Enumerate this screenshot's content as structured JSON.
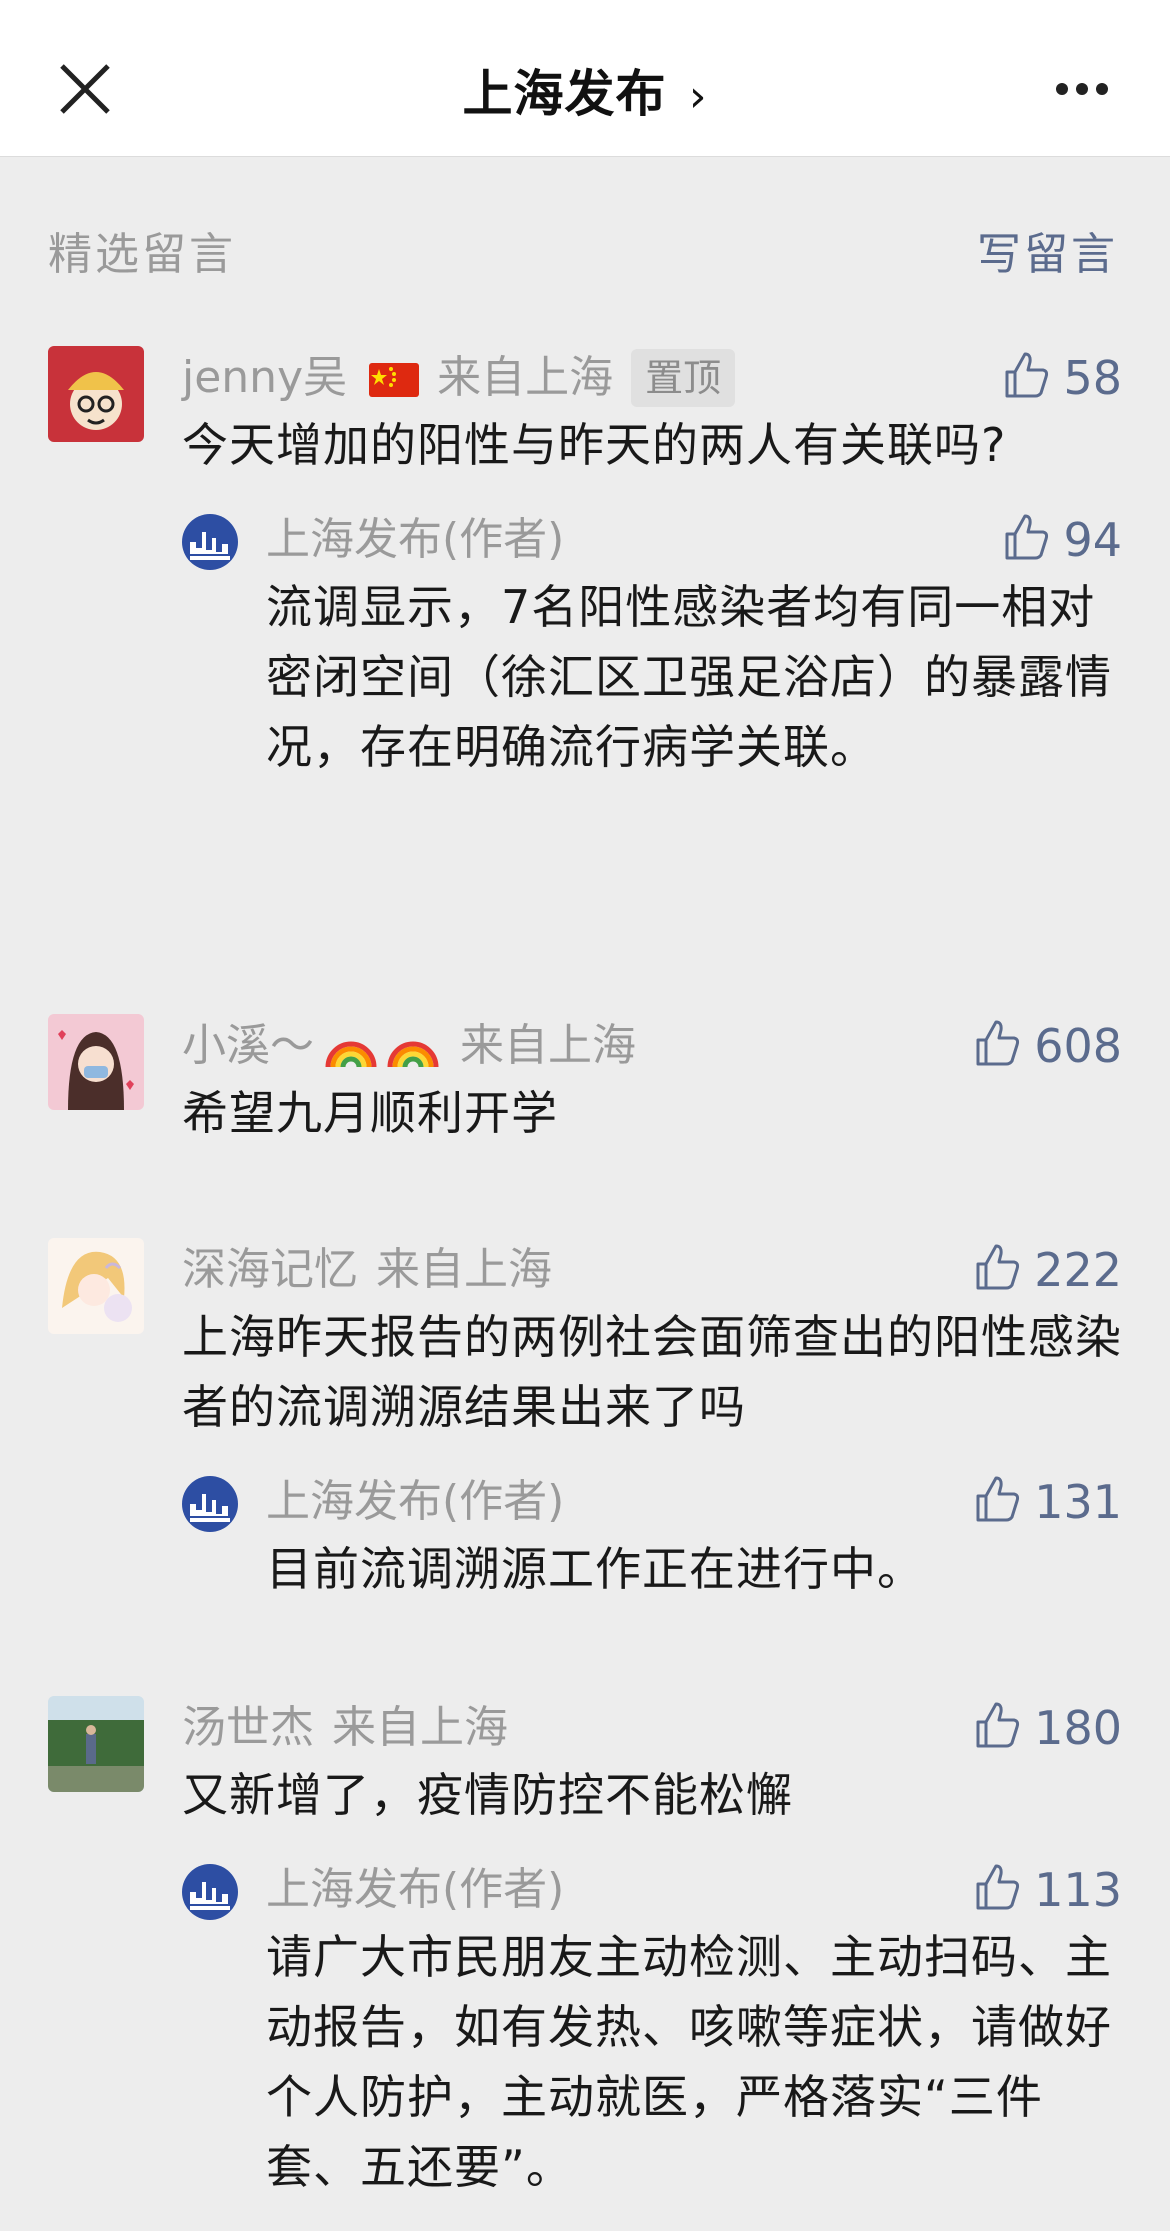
{
  "nav": {
    "title": "上海发布",
    "arrow": "›"
  },
  "section": {
    "label": "精选留言",
    "write": "写留言"
  },
  "comments": [
    {
      "name": "jenny吴",
      "location": "来自上海",
      "tag": "置顶",
      "likes": "58",
      "text": "今天增加的阳性与昨天的两人有关联吗?",
      "reply": {
        "name": "上海发布(作者)",
        "likes": "94",
        "text": "流调显示，7名阳性感染者均有同一相对密闭空间（徐汇区卫强足浴店）的暴露情况，存在明确流行病学关联。"
      }
    },
    {
      "name": "小溪～",
      "location": "来自上海",
      "likes": "608",
      "text": "希望九月顺利开学"
    },
    {
      "name": "深海记忆",
      "location": "来自上海",
      "likes": "222",
      "text": "上海昨天报告的两例社会面筛查出的阳性感染者的流调溯源结果出来了吗",
      "reply": {
        "name": "上海发布(作者)",
        "likes": "131",
        "text": "目前流调溯源工作正在进行中。"
      }
    },
    {
      "name": "汤世杰",
      "location": "来自上海",
      "likes": "180",
      "text": "又新增了，疫情防控不能松懈",
      "reply": {
        "name": "上海发布(作者)",
        "likes": "113",
        "text": "请广大市民朋友主动检测、主动扫码、主动报告，如有发热、咳嗽等症状，请做好个人防护，主动就医，严格落实“三件套、五还要”。"
      }
    }
  ],
  "colors": {
    "accent": "#5b6b8d",
    "meta": "#9a9a9a",
    "background": "#ededed"
  }
}
